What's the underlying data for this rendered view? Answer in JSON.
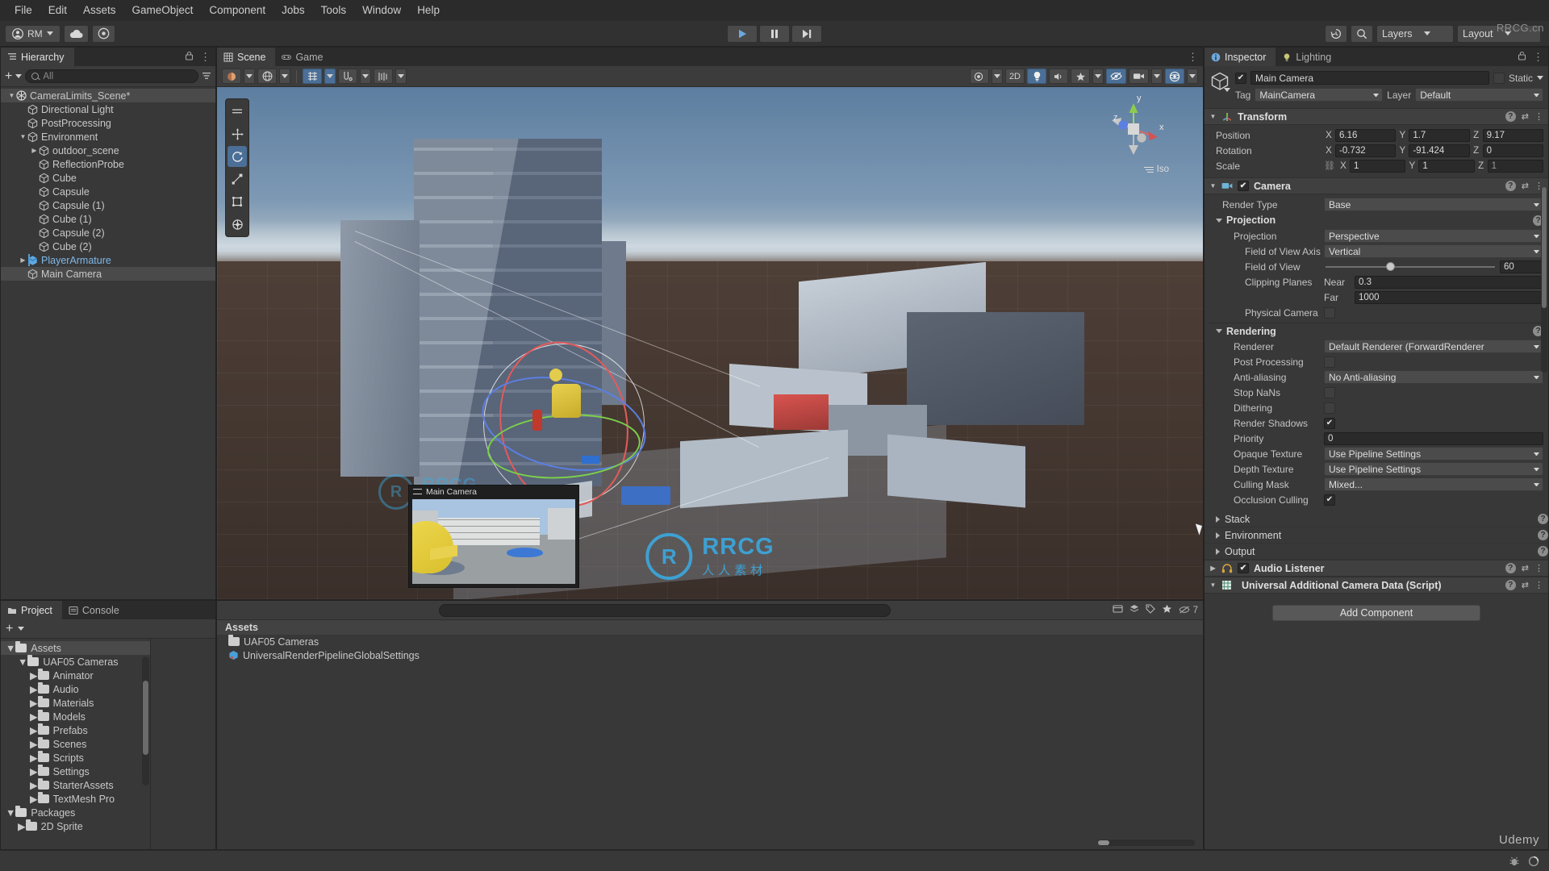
{
  "menubar": {
    "items": [
      "File",
      "Edit",
      "Assets",
      "GameObject",
      "Component",
      "Jobs",
      "Tools",
      "Window",
      "Help"
    ]
  },
  "toolbar": {
    "account_label": "RM",
    "cloud_icon": "cloud-icon",
    "services_icon": "services-icon",
    "play_icon": "play-icon",
    "pause_icon": "pause-icon",
    "step_icon": "step-icon",
    "undo_history_icon": "history-icon",
    "search_icon": "search-icon",
    "layers_label": "Layers",
    "layout_label": "Layout",
    "watermark": "RRCG.cn"
  },
  "hierarchy": {
    "tab_label": "Hierarchy",
    "tab_icon": "hierarchy-icon",
    "add_label": "+",
    "search_placeholder": "All",
    "items": [
      {
        "label": "CameraLimits_Scene*",
        "depth": 0,
        "expanded": true,
        "kind": "scene",
        "selected": false
      },
      {
        "label": "Directional Light",
        "depth": 1,
        "expanded": null,
        "kind": "object",
        "selected": false
      },
      {
        "label": "PostProcessing",
        "depth": 1,
        "expanded": null,
        "kind": "object",
        "selected": false
      },
      {
        "label": "Environment",
        "depth": 1,
        "expanded": true,
        "kind": "object",
        "selected": false
      },
      {
        "label": "outdoor_scene",
        "depth": 2,
        "expanded": false,
        "kind": "object",
        "selected": false
      },
      {
        "label": "ReflectionProbe",
        "depth": 2,
        "expanded": null,
        "kind": "object",
        "selected": false
      },
      {
        "label": "Cube",
        "depth": 2,
        "expanded": null,
        "kind": "object",
        "selected": false
      },
      {
        "label": "Capsule",
        "depth": 2,
        "expanded": null,
        "kind": "object",
        "selected": false
      },
      {
        "label": "Capsule (1)",
        "depth": 2,
        "expanded": null,
        "kind": "object",
        "selected": false
      },
      {
        "label": "Cube (1)",
        "depth": 2,
        "expanded": null,
        "kind": "object",
        "selected": false
      },
      {
        "label": "Capsule (2)",
        "depth": 2,
        "expanded": null,
        "kind": "object",
        "selected": false
      },
      {
        "label": "Cube (2)",
        "depth": 2,
        "expanded": null,
        "kind": "object",
        "selected": false
      },
      {
        "label": "PlayerArmature",
        "depth": 1,
        "expanded": false,
        "kind": "prefab",
        "selected": false
      },
      {
        "label": "Main Camera",
        "depth": 1,
        "expanded": null,
        "kind": "object",
        "selected": true
      }
    ]
  },
  "scene": {
    "tabs": [
      {
        "label": "Scene",
        "icon": "scene-grid-icon",
        "active": true
      },
      {
        "label": "Game",
        "icon": "game-pad-icon",
        "active": false
      }
    ],
    "toolbar": {
      "draw_mode": "shaded-icon",
      "twod_label": "2D",
      "lighting_icon": "light-bulb-icon",
      "audio_icon": "audio-icon",
      "fx_icon": "effects-icon",
      "scene_vis_icon": "scene-visibility-icon",
      "camera_icon": "scene-camera-icon",
      "gizmos_icon": "gizmos-icon"
    },
    "vertical_tools": [
      {
        "name": "tool-select-strip",
        "icon": "strip-icon",
        "active": false
      },
      {
        "name": "move-tool",
        "icon": "move-icon",
        "active": false
      },
      {
        "name": "rotate-tool",
        "icon": "rotate-icon",
        "active": true
      },
      {
        "name": "scale-tool",
        "icon": "scale-icon",
        "active": false
      },
      {
        "name": "rect-tool",
        "icon": "rect-icon",
        "active": false
      },
      {
        "name": "transform-tool",
        "icon": "transform-icon",
        "active": false
      }
    ],
    "gizmo": {
      "x_label": "x",
      "y_label": "y",
      "z_label": "z",
      "mode_label": "Iso"
    },
    "camera_preview": {
      "title": "Main Camera"
    },
    "watermark": {
      "initials": "R",
      "brand": "RRCG",
      "sub": "人人素材"
    }
  },
  "project": {
    "tabs": [
      {
        "label": "Project",
        "icon": "folder-icon",
        "active": true
      },
      {
        "label": "Console",
        "icon": "console-icon",
        "active": false
      }
    ],
    "add_label": "+",
    "search_placeholder": "",
    "tree": [
      {
        "label": "Assets",
        "depth": 0,
        "expanded": true,
        "selected": true
      },
      {
        "label": "UAF05 Cameras",
        "depth": 1,
        "expanded": true,
        "selected": false
      },
      {
        "label": "Animator",
        "depth": 2,
        "expanded": null,
        "selected": false
      },
      {
        "label": "Audio",
        "depth": 2,
        "expanded": null,
        "selected": false
      },
      {
        "label": "Materials",
        "depth": 2,
        "expanded": null,
        "selected": false
      },
      {
        "label": "Models",
        "depth": 2,
        "expanded": null,
        "selected": false
      },
      {
        "label": "Prefabs",
        "depth": 2,
        "expanded": null,
        "selected": false
      },
      {
        "label": "Scenes",
        "depth": 2,
        "expanded": false,
        "selected": false
      },
      {
        "label": "Scripts",
        "depth": 2,
        "expanded": null,
        "selected": false
      },
      {
        "label": "Settings",
        "depth": 2,
        "expanded": false,
        "selected": false
      },
      {
        "label": "StarterAssets",
        "depth": 2,
        "expanded": false,
        "selected": false
      },
      {
        "label": "TextMesh Pro",
        "depth": 2,
        "expanded": false,
        "selected": false
      },
      {
        "label": "Packages",
        "depth": 0,
        "expanded": true,
        "selected": false
      },
      {
        "label": "2D Sprite",
        "depth": 1,
        "expanded": false,
        "selected": false
      }
    ],
    "content_header": "Assets",
    "content_items": [
      {
        "label": "UAF05 Cameras",
        "icon": "folder-icon"
      },
      {
        "label": "UniversalRenderPipelineGlobalSettings",
        "icon": "asset-icon"
      }
    ],
    "count_badge": "7"
  },
  "inspector": {
    "tabs": [
      {
        "label": "Inspector",
        "icon": "info-icon",
        "active": true
      },
      {
        "label": "Lighting",
        "icon": "light-bulb-icon",
        "active": false
      }
    ],
    "lock_icon": "lock-icon",
    "menu_icon": "kebab-icon",
    "gameobject": {
      "enabled": true,
      "name": "Main Camera",
      "static_label": "Static",
      "static_checked": false,
      "tag_label": "Tag",
      "tag_value": "MainCamera",
      "layer_label": "Layer",
      "layer_value": "Default"
    },
    "transform": {
      "title": "Transform",
      "icon": "transform-icon",
      "rows": [
        {
          "label": "Position",
          "x": "6.16",
          "y": "1.7",
          "z": "9.17"
        },
        {
          "label": "Rotation",
          "x": "-0.732",
          "y": "-91.424",
          "z": "0"
        },
        {
          "label": "Scale",
          "x": "1",
          "y": "1",
          "z": "1"
        }
      ],
      "scale_lock_icon": "link-broken-icon"
    },
    "camera": {
      "title": "Camera",
      "icon": "camera-icon",
      "enabled": true,
      "render_type_label": "Render Type",
      "render_type_value": "Base",
      "projection_section": "Projection",
      "projection_label": "Projection",
      "projection_value": "Perspective",
      "fov_axis_label": "Field of View Axis",
      "fov_axis_value": "Vertical",
      "fov_label": "Field of View",
      "fov_value": "60",
      "clipping_label": "Clipping Planes",
      "near_label": "Near",
      "near_value": "0.3",
      "far_label": "Far",
      "far_value": "1000",
      "physical_camera_label": "Physical Camera",
      "physical_camera_checked": false,
      "rendering_section": "Rendering",
      "rendering_rows": [
        {
          "label": "Renderer",
          "type": "dropdown",
          "value": "Default Renderer (ForwardRenderer"
        },
        {
          "label": "Post Processing",
          "type": "checkbox",
          "checked": false
        },
        {
          "label": "Anti-aliasing",
          "type": "dropdown",
          "value": "No Anti-aliasing"
        },
        {
          "label": "Stop NaNs",
          "type": "checkbox",
          "checked": false
        },
        {
          "label": "Dithering",
          "type": "checkbox",
          "checked": false
        },
        {
          "label": "Render Shadows",
          "type": "checkbox",
          "checked": true
        },
        {
          "label": "Priority",
          "type": "number",
          "value": "0"
        },
        {
          "label": "Opaque Texture",
          "type": "dropdown",
          "value": "Use Pipeline Settings"
        },
        {
          "label": "Depth Texture",
          "type": "dropdown",
          "value": "Use Pipeline Settings"
        },
        {
          "label": "Culling Mask",
          "type": "dropdown",
          "value": "Mixed..."
        },
        {
          "label": "Occlusion Culling",
          "type": "checkbox",
          "checked": true
        }
      ],
      "collapsed_sections": [
        "Stack",
        "Environment",
        "Output"
      ]
    },
    "audio_listener": {
      "title": "Audio Listener",
      "icon": "headphones-icon",
      "enabled": true
    },
    "script_component": {
      "title": "Universal Additional Camera Data (Script)",
      "icon": "script-icon"
    },
    "add_component_label": "Add Component"
  },
  "statusbar": {
    "bug_icon": "bug-icon",
    "progress_icon": "progress-icon",
    "watermark": "Udemy"
  },
  "colors": {
    "accent_blue": "#4b6f96",
    "selection": "#4a4a4a",
    "panel_bg": "#383838",
    "header_bg": "#2b2b2b",
    "prefab_blue": "#7fb8e8",
    "watermark_blue": "#3aa9e0"
  }
}
